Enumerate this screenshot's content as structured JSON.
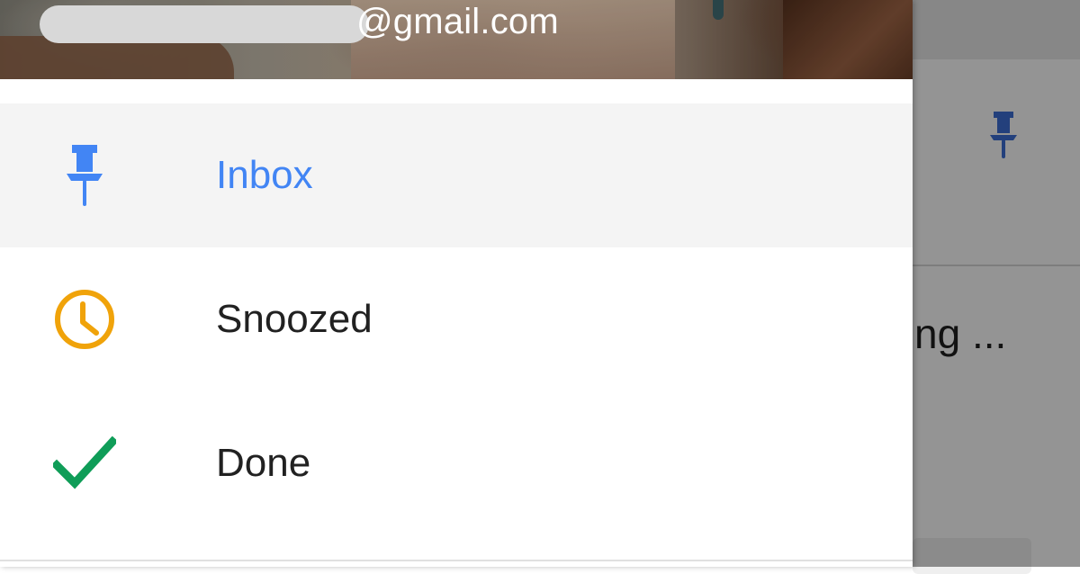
{
  "account": {
    "email_visible": "@gmail.com"
  },
  "nav": {
    "items": [
      {
        "label": "Inbox",
        "icon": "pin-icon",
        "color": "#4285f4",
        "selected": true
      },
      {
        "label": "Snoozed",
        "icon": "clock-icon",
        "color": "#f0a30a",
        "selected": false
      },
      {
        "label": "Done",
        "icon": "checkmark-icon",
        "color": "#0f9d58",
        "selected": false
      }
    ]
  },
  "background_app": {
    "snippet": "ng ...",
    "pin_color": "#3d6fd6"
  },
  "colors": {
    "selected_text": "#4285f4",
    "selected_bg": "#f4f4f4"
  }
}
